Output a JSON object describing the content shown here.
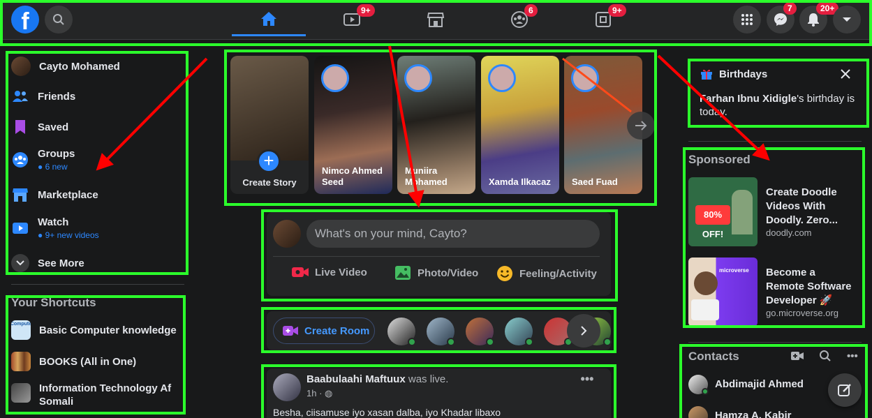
{
  "topbar": {
    "logo_letter": "f",
    "tabs": [
      {
        "name": "home",
        "badge": ""
      },
      {
        "name": "watch",
        "badge": "9+"
      },
      {
        "name": "marketplace",
        "badge": ""
      },
      {
        "name": "groups",
        "badge": "6"
      },
      {
        "name": "gaming",
        "badge": "9+"
      }
    ],
    "messenger_badge": "7",
    "notifications_badge": "20+"
  },
  "sidebar": {
    "items": [
      {
        "label": "Cayto Mohamed",
        "sub": ""
      },
      {
        "label": "Friends",
        "sub": ""
      },
      {
        "label": "Saved",
        "sub": ""
      },
      {
        "label": "Groups",
        "sub": "6 new"
      },
      {
        "label": "Marketplace",
        "sub": ""
      },
      {
        "label": "Watch",
        "sub": "9+ new videos"
      },
      {
        "label": "See More",
        "sub": ""
      }
    ]
  },
  "shortcuts": {
    "title": "Your Shortcuts",
    "items": [
      {
        "label": "Basic Computer knowledge",
        "thumb_text": "Compute"
      },
      {
        "label": "BOOKS (All in One)"
      },
      {
        "label": "Information Technology Af Somali"
      }
    ]
  },
  "stories": {
    "create_label": "Create Story",
    "items": [
      {
        "name_line1": "Nimco Ahmed",
        "name_line2": "Seed"
      },
      {
        "name_line1": "Muniira",
        "name_line2": "Mohamed"
      },
      {
        "name_line1": "Xamda Ilkacaz",
        "name_line2": ""
      },
      {
        "name_line1": "Saed Fuad",
        "name_line2": ""
      }
    ]
  },
  "composer": {
    "placeholder": "What's on your mind, Cayto?",
    "actions": [
      "Live Video",
      "Photo/Video",
      "Feeling/Activity"
    ]
  },
  "rooms": {
    "create_label": "Create Room"
  },
  "post": {
    "author": "Baabulaahi Maftuux",
    "action": " was live.",
    "time": "1h · ",
    "text": "Besha, ciisamuse iyo xasan dalba, iyo Khadar libaxo"
  },
  "birthdays": {
    "title": "Birthdays",
    "name": "Farhan Ibnu Xidigle",
    "text": "'s birthday is today."
  },
  "sponsored": {
    "title": "Sponsored",
    "ads": [
      {
        "title": "Create Doodle Videos With Doodly. Zero...",
        "domain": "doodly.com",
        "img_text": "80% OFF!"
      },
      {
        "title": "Become a Remote Software Developer 🚀",
        "domain": "go.microverse.org",
        "img_text": "microverse"
      }
    ]
  },
  "contacts": {
    "title": "Contacts",
    "items": [
      "Abdimajid Ahmed",
      "Hamza A. Kabir"
    ]
  },
  "colors": {
    "accent": "#2d88ff",
    "annotation_box": "#2bff2b",
    "annotation_arrow": "#ff0000",
    "badge": "#e41e3f"
  }
}
